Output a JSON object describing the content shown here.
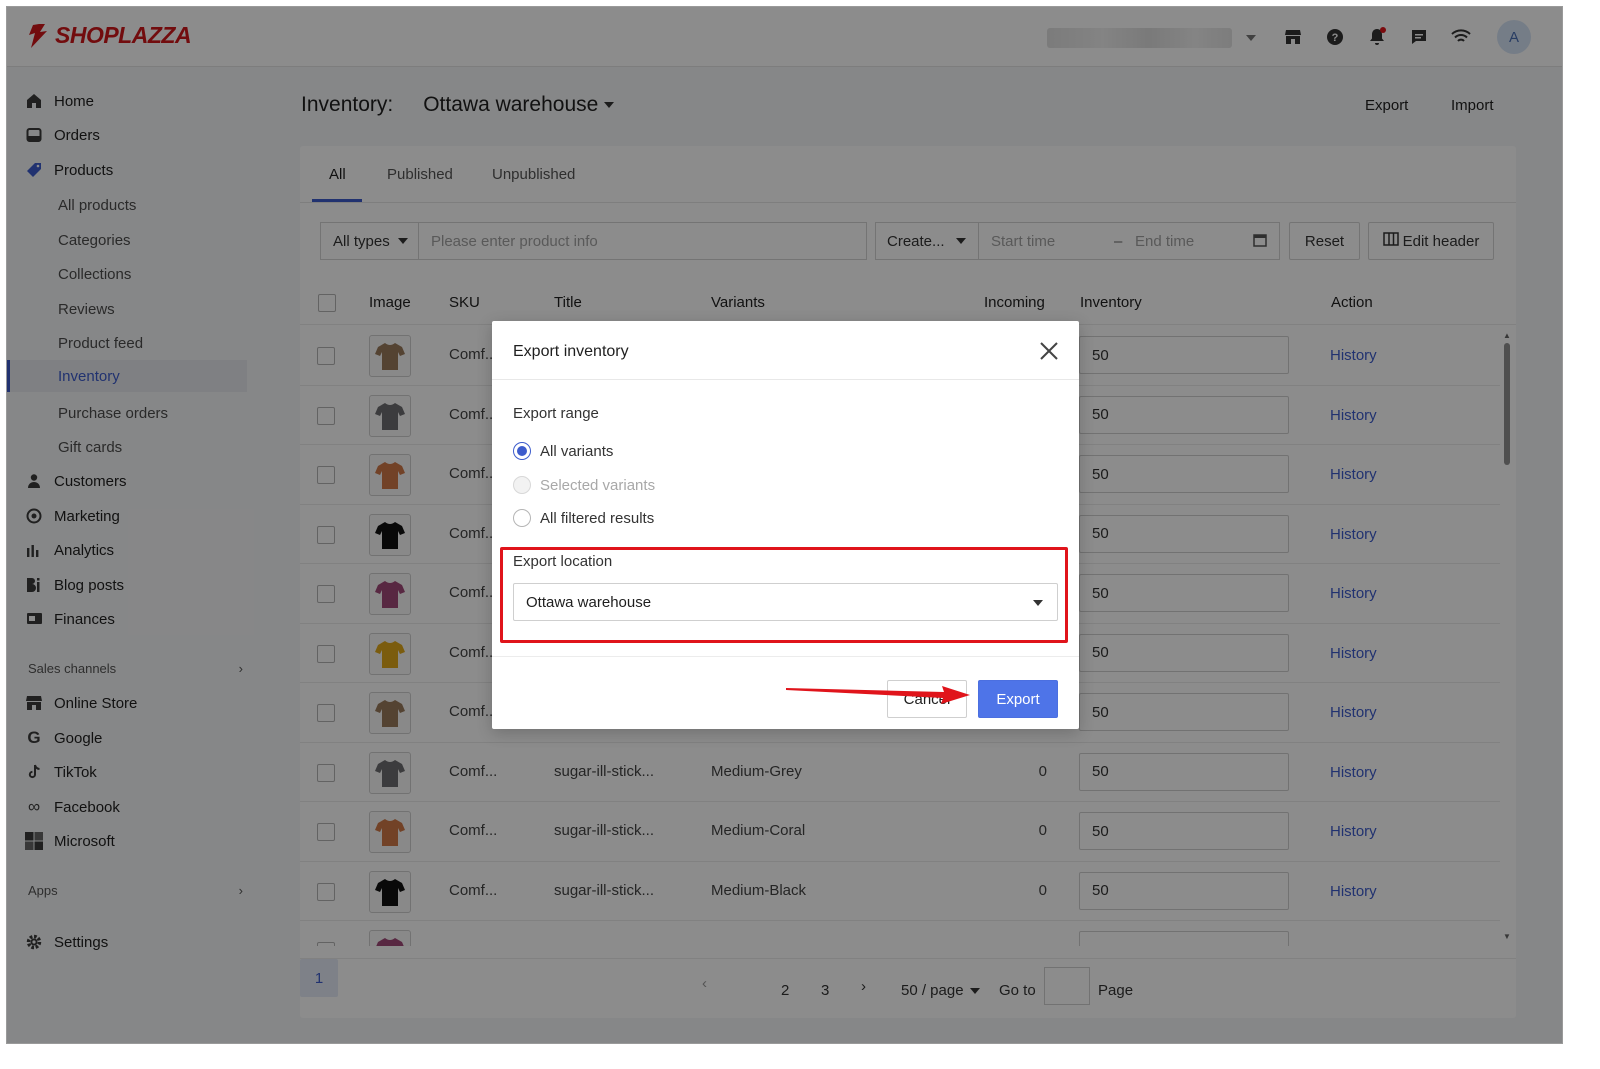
{
  "app": {
    "brand": "SHOPLAZZA",
    "avatar_initial": "A",
    "accent_color": "#3d5ccc",
    "highlight_color": "#e0141b"
  },
  "topbar": {
    "icons": [
      "store-icon",
      "help-icon",
      "bell-icon",
      "chat-icon",
      "wifi-icon"
    ]
  },
  "sidebar": {
    "items": [
      {
        "label": "Home",
        "icon": "home-icon"
      },
      {
        "label": "Orders",
        "icon": "inbox-icon"
      },
      {
        "label": "Products",
        "icon": "tag-icon"
      },
      {
        "label": "Customers",
        "icon": "person-icon"
      },
      {
        "label": "Marketing",
        "icon": "target-icon"
      },
      {
        "label": "Analytics",
        "icon": "bar-chart-icon"
      },
      {
        "label": "Blog posts",
        "icon": "blog-icon"
      },
      {
        "label": "Finances",
        "icon": "finance-icon"
      }
    ],
    "products_sub": [
      "All products",
      "Categories",
      "Collections",
      "Reviews",
      "Product feed",
      "Inventory",
      "Purchase orders",
      "Gift cards"
    ],
    "sales_channels_label": "Sales channels",
    "channels": [
      {
        "label": "Online Store",
        "icon": "store-icon"
      },
      {
        "label": "Google",
        "icon": "google-icon"
      },
      {
        "label": "TikTok",
        "icon": "tiktok-icon"
      },
      {
        "label": "Facebook",
        "icon": "meta-icon"
      },
      {
        "label": "Microsoft",
        "icon": "microsoft-icon"
      }
    ],
    "apps_label": "Apps",
    "settings_label": "Settings"
  },
  "page": {
    "title": "Inventory:",
    "location": "Ottawa warehouse",
    "export_label": "Export",
    "import_label": "Import"
  },
  "tabs": [
    "All",
    "Published",
    "Unpublished"
  ],
  "filters": {
    "type_select": "All types",
    "search_placeholder": "Please enter product info",
    "created_select": "Create...",
    "start_placeholder": "Start time",
    "end_placeholder": "End time",
    "reset_label": "Reset",
    "edit_header_label": "Edit header"
  },
  "table": {
    "headers": {
      "image": "Image",
      "sku": "SKU",
      "title": "Title",
      "variants": "Variants",
      "incoming": "Incoming",
      "inventory": "Inventory",
      "action": "Action"
    },
    "rows": [
      {
        "sku": "Comf...",
        "title": "",
        "variant": "",
        "incoming": "",
        "inventory": "50",
        "action": "History",
        "color": "#9a7b5c"
      },
      {
        "sku": "Comf...",
        "title": "",
        "variant": "",
        "incoming": "",
        "inventory": "50",
        "action": "History",
        "color": "#6e6e72"
      },
      {
        "sku": "Comf...",
        "title": "",
        "variant": "",
        "incoming": "",
        "inventory": "50",
        "action": "History",
        "color": "#d07848"
      },
      {
        "sku": "Comf...",
        "title": "",
        "variant": "",
        "incoming": "",
        "inventory": "50",
        "action": "History",
        "color": "#111111"
      },
      {
        "sku": "Comf...",
        "title": "",
        "variant": "",
        "incoming": "",
        "inventory": "50",
        "action": "History",
        "color": "#a04a78"
      },
      {
        "sku": "Comf...",
        "title": "",
        "variant": "",
        "incoming": "",
        "inventory": "50",
        "action": "History",
        "color": "#e0a81a"
      },
      {
        "sku": "Comf...",
        "title": "",
        "variant": "",
        "incoming": "",
        "inventory": "50",
        "action": "History",
        "color": "#9a7b5c"
      },
      {
        "sku": "Comf...",
        "title": "sugar-ill-stick...",
        "variant": "Medium-Grey",
        "incoming": "0",
        "inventory": "50",
        "action": "History",
        "color": "#6e6e72"
      },
      {
        "sku": "Comf...",
        "title": "sugar-ill-stick...",
        "variant": "Medium-Coral",
        "incoming": "0",
        "inventory": "50",
        "action": "History",
        "color": "#d07848"
      },
      {
        "sku": "Comf...",
        "title": "sugar-ill-stick...",
        "variant": "Medium-Black",
        "incoming": "0",
        "inventory": "50",
        "action": "History",
        "color": "#111111"
      },
      {
        "sku": "",
        "title": "",
        "variant": "",
        "incoming": "",
        "inventory": "",
        "action": "",
        "color": "#a04a78"
      }
    ]
  },
  "pager": {
    "pages": [
      "1",
      "2",
      "3"
    ],
    "per_page": "50 / page",
    "goto_label": "Go to",
    "page_label": "Page"
  },
  "modal": {
    "title": "Export inventory",
    "range_label": "Export range",
    "options": [
      "All variants",
      "Selected variants",
      "All filtered results"
    ],
    "selected_option": "All variants",
    "location_label": "Export location",
    "location_value": "Ottawa warehouse",
    "cancel_label": "Cancel",
    "export_label": "Export"
  }
}
